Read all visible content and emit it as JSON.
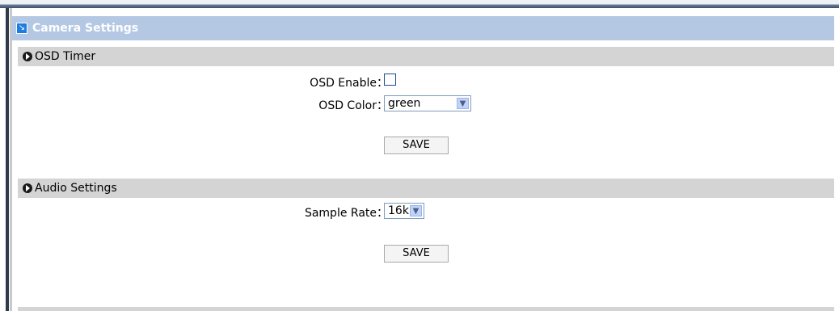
{
  "panel": {
    "title": "Camera Settings",
    "corner_icon": "expand-arrow-icon"
  },
  "osd_section": {
    "title": "OSD Timer",
    "enable_label": "OSD Enable：",
    "enable_checked": false,
    "color_label": "OSD Color：",
    "color_value": "green",
    "save_label": "SAVE"
  },
  "audio_section": {
    "title": "Audio Settings",
    "sample_rate_label": "Sample Rate：",
    "sample_rate_value": "16k",
    "save_label": "SAVE"
  }
}
